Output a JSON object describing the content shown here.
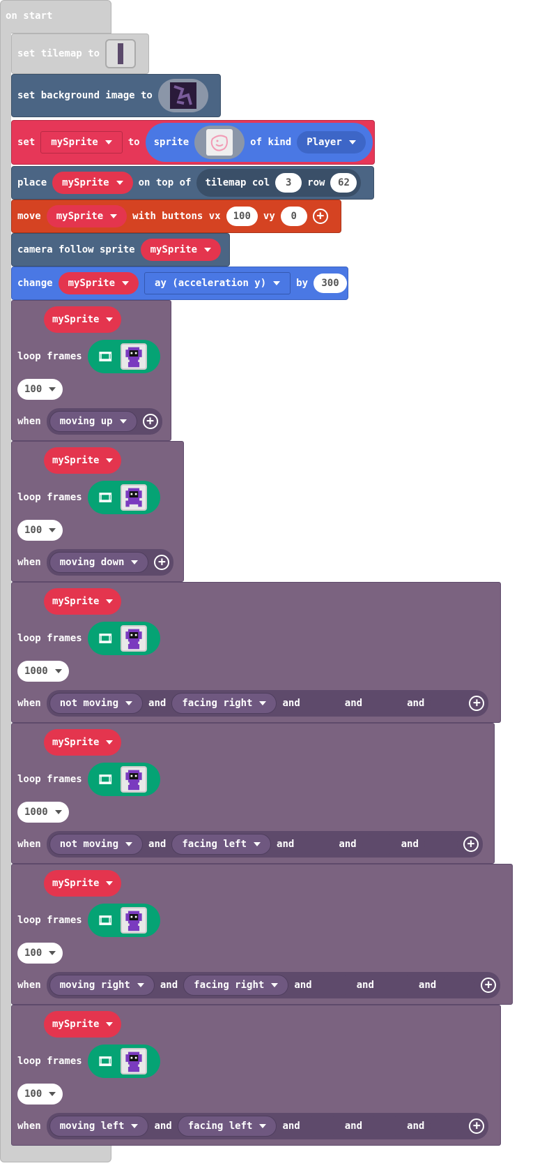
{
  "on_start": {
    "label": "on start"
  },
  "tilemap_block": {
    "label": "set tilemap to"
  },
  "background_block": {
    "label": "set background image to"
  },
  "set_sprite_block": {
    "set": "set",
    "var": "mySprite",
    "to": "to",
    "sprite": "sprite",
    "of_kind": "of kind",
    "kind": "Player"
  },
  "place_block": {
    "place": "place",
    "var": "mySprite",
    "on_top_of": "on top of",
    "tilemap_col": "tilemap col",
    "col": "3",
    "row_label": "row",
    "row": "62"
  },
  "move_block": {
    "move": "move",
    "var": "mySprite",
    "with_buttons": "with buttons vx",
    "vx": "100",
    "vy_label": "vy",
    "vy": "0"
  },
  "camera_block": {
    "label": "camera follow sprite",
    "var": "mySprite"
  },
  "change_block": {
    "change": "change",
    "var": "mySprite",
    "prop": "ay (acceleration y)",
    "by": "by",
    "value": "300"
  },
  "anim_labels": {
    "loop_frames": "loop frames",
    "when": "when",
    "and": "and"
  },
  "anims": [
    {
      "sprite": "mySprite",
      "interval": "100",
      "conditions": [
        "moving up"
      ],
      "slots": 0
    },
    {
      "sprite": "mySprite",
      "interval": "100",
      "conditions": [
        "moving down"
      ],
      "slots": 0
    },
    {
      "sprite": "mySprite",
      "interval": "1000",
      "conditions": [
        "not moving",
        "facing right"
      ],
      "slots": 3
    },
    {
      "sprite": "mySprite",
      "interval": "1000",
      "conditions": [
        "not moving",
        "facing left"
      ],
      "slots": 3
    },
    {
      "sprite": "mySprite",
      "interval": "100",
      "conditions": [
        "moving right",
        "facing right"
      ],
      "slots": 3
    },
    {
      "sprite": "mySprite",
      "interval": "100",
      "conditions": [
        "moving left",
        "facing left"
      ],
      "slots": 3
    }
  ],
  "colors": {
    "event_disabled": "#cfcfcf",
    "scene": "#4b6584",
    "sprites": "#e63758",
    "controller": "#d54322",
    "animation": "#7b6380",
    "anim_pill": "#05a374",
    "kind_blue": "#4a78e4"
  },
  "icons": [
    "film-icon",
    "plus-icon",
    "dropdown-caret-icon",
    "tilemap-thumbnail",
    "background-thumbnail",
    "sprite-thumbnail",
    "character-thumbnail"
  ]
}
